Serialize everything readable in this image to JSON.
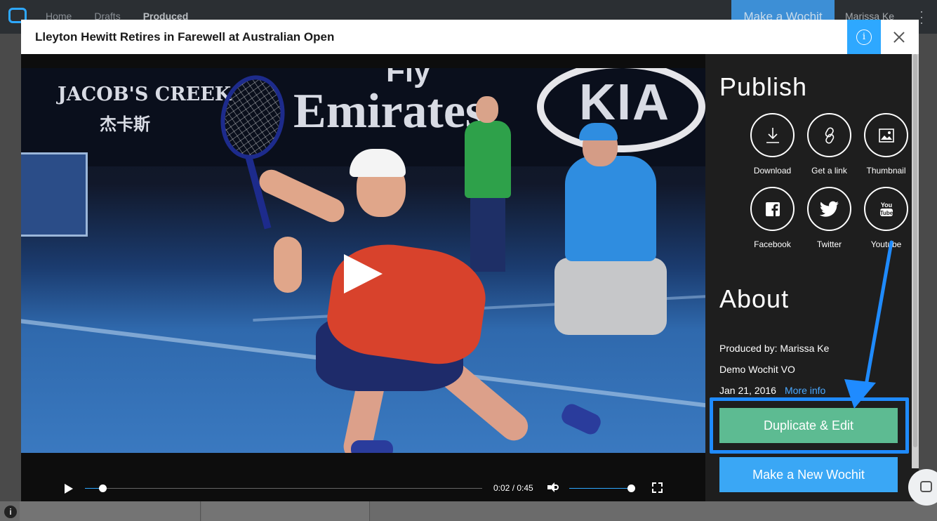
{
  "topbar": {
    "nav": [
      "Home",
      "Drafts",
      "Produced"
    ],
    "active": "Produced",
    "make_button": "Make a Wochit",
    "user": "Marissa Ke"
  },
  "modal": {
    "title": "Lleyton Hewitt Retires in Farewell at Australian Open",
    "info_icon": "info-icon",
    "close_icon": "close-icon"
  },
  "video": {
    "banner_text": {
      "sponsor_1": "JACOB'S CREEK",
      "sponsor_1_sub": "杰卡斯",
      "sponsor_2": "Emirates",
      "sponsor_2_top": "Fly",
      "sponsor_3": "KIA"
    },
    "controls": {
      "time": "0:02 / 0:45",
      "progress": 0.045,
      "volume": 1.0
    }
  },
  "publish": {
    "heading": "Publish",
    "items": [
      {
        "label": "Download",
        "icon": "download-icon"
      },
      {
        "label": "Get a link",
        "icon": "link-icon"
      },
      {
        "label": "Thumbnail",
        "icon": "image-icon"
      },
      {
        "label": "Facebook",
        "icon": "facebook-icon"
      },
      {
        "label": "Twitter",
        "icon": "twitter-icon"
      },
      {
        "label": "Youtube",
        "icon": "youtube-icon"
      }
    ]
  },
  "about": {
    "heading": "About",
    "produced_by": "Produced by: Marissa Ke",
    "voice": "Demo Wochit VO",
    "date": "Jan 21, 2016",
    "more_info": "More info"
  },
  "actions": {
    "duplicate": "Duplicate & Edit",
    "new": "Make a New Wochit"
  },
  "colors": {
    "accent": "#2ea8ff",
    "duplicate_green": "#5dbb92",
    "highlight_blue": "#1f8bff"
  }
}
